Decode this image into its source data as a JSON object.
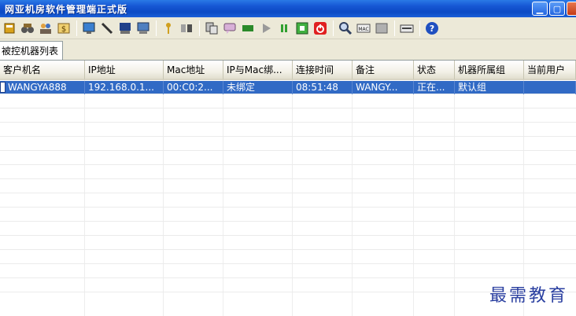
{
  "window": {
    "title": "网亚机房软件管理端正式版",
    "controls": [
      "minimize",
      "maximize",
      "close"
    ]
  },
  "toolbar": {
    "groups": [
      [
        "user-icon",
        "binoculars-icon",
        "group-icon",
        "dollar-icon"
      ],
      [
        "screen-icon",
        "pen-icon",
        "monitor-icon",
        "display-icon"
      ],
      [
        "key-icon",
        "users-tool-icon"
      ],
      [
        "copy-icon",
        "chat-icon",
        "message-icon",
        "play-icon",
        "pause-icon",
        "network-icon",
        "power-icon"
      ],
      [
        "search-computer-icon",
        "mac-icon",
        "hardware-icon"
      ],
      [
        "keyboard-icon"
      ],
      [
        "help-icon"
      ]
    ]
  },
  "tabs": [
    {
      "label": "被控机器列表",
      "active": true
    }
  ],
  "table": {
    "columns": [
      "客户机名",
      "IP地址",
      "Mac地址",
      "IP与Mac绑...",
      "连接时间",
      "备注",
      "状态",
      "机器所属组",
      "当前用户"
    ],
    "rows": [
      {
        "cells": [
          "WANGYA888",
          "192.168.0.1...",
          "00:C0:2...",
          "未绑定",
          "08:51:48",
          "WANGY...",
          "正在...",
          "默认组",
          ""
        ],
        "selected": true
      }
    ]
  },
  "watermark": "最需教育"
}
